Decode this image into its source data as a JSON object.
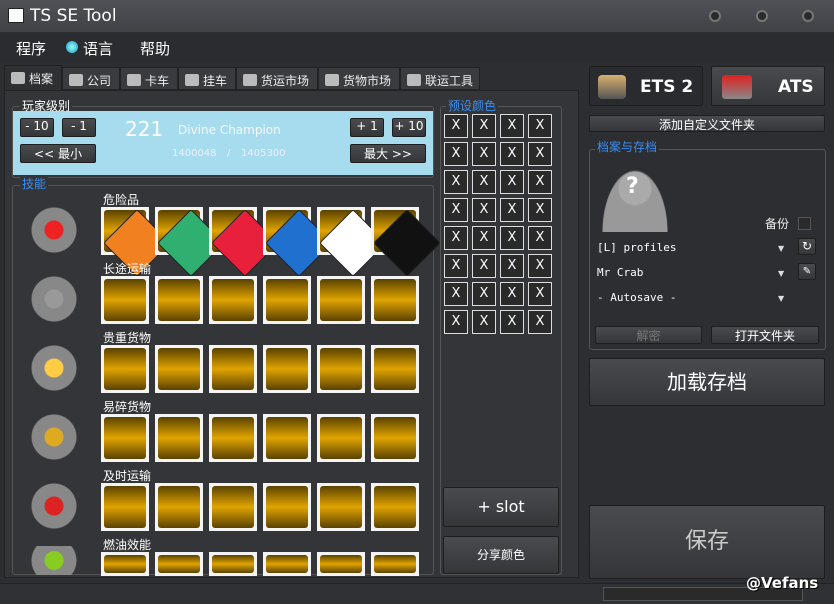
{
  "window": {
    "title": "TS SE Tool"
  },
  "menu": [
    "程序",
    "语言",
    "帮助"
  ],
  "tabs": [
    "档案",
    "公司",
    "卡车",
    "挂车",
    "货运市场",
    "货物市场",
    "联运工具"
  ],
  "player_level": {
    "group_label": "玩家级别",
    "minus10": "- 10",
    "minus1": "- 1",
    "plus1": "+ 1",
    "plus10": "+ 10",
    "min": "<< 最小",
    "max": "最大 >>",
    "level": "221",
    "rank": "Divine Champion",
    "xp": "1400048",
    "xp_sep": "/",
    "xp_next": "1405300"
  },
  "skills": {
    "group_label": "技能",
    "rows": [
      {
        "label": "危险品",
        "icon": "adr-fire-icon",
        "level": 6
      },
      {
        "label": "长途运输",
        "icon": "long-distance-road-icon",
        "level": 6
      },
      {
        "label": "贵重货物",
        "icon": "valuable-star-icon",
        "level": 6
      },
      {
        "label": "易碎货物",
        "icon": "fragile-glass-icon",
        "level": 6
      },
      {
        "label": "及时运输",
        "icon": "just-in-time-clock-icon",
        "level": 6
      },
      {
        "label": "燃油效能",
        "icon": "eco-leaf-gear-icon",
        "level": 6
      }
    ],
    "adr_colors": [
      "#f08020",
      "#30b070",
      "#e8203c",
      "#2070d0",
      "#ffffff",
      "#111111"
    ]
  },
  "preset_colors": {
    "group_label": "预设颜色",
    "cell": "X",
    "add_slot": "+ slot",
    "share": "分享颜色"
  },
  "games": {
    "ets2": "ETS 2",
    "ats": "ATS"
  },
  "add_folder": "添加自定义文件夹",
  "profiles": {
    "group_label": "档案与存档",
    "backup": "备份",
    "profile_folder": "[L] profiles",
    "profile": "Mr Crab",
    "save": "- Autosave -",
    "decrypt": "解密",
    "open_folder": "打开文件夹"
  },
  "load_save": "加载存档",
  "save_button": "保存",
  "watermark": "@Vefans",
  "colors": {
    "level_bg": "#a6dcee",
    "accent": "#3b8df0",
    "slot_gold": "#e0a400"
  }
}
